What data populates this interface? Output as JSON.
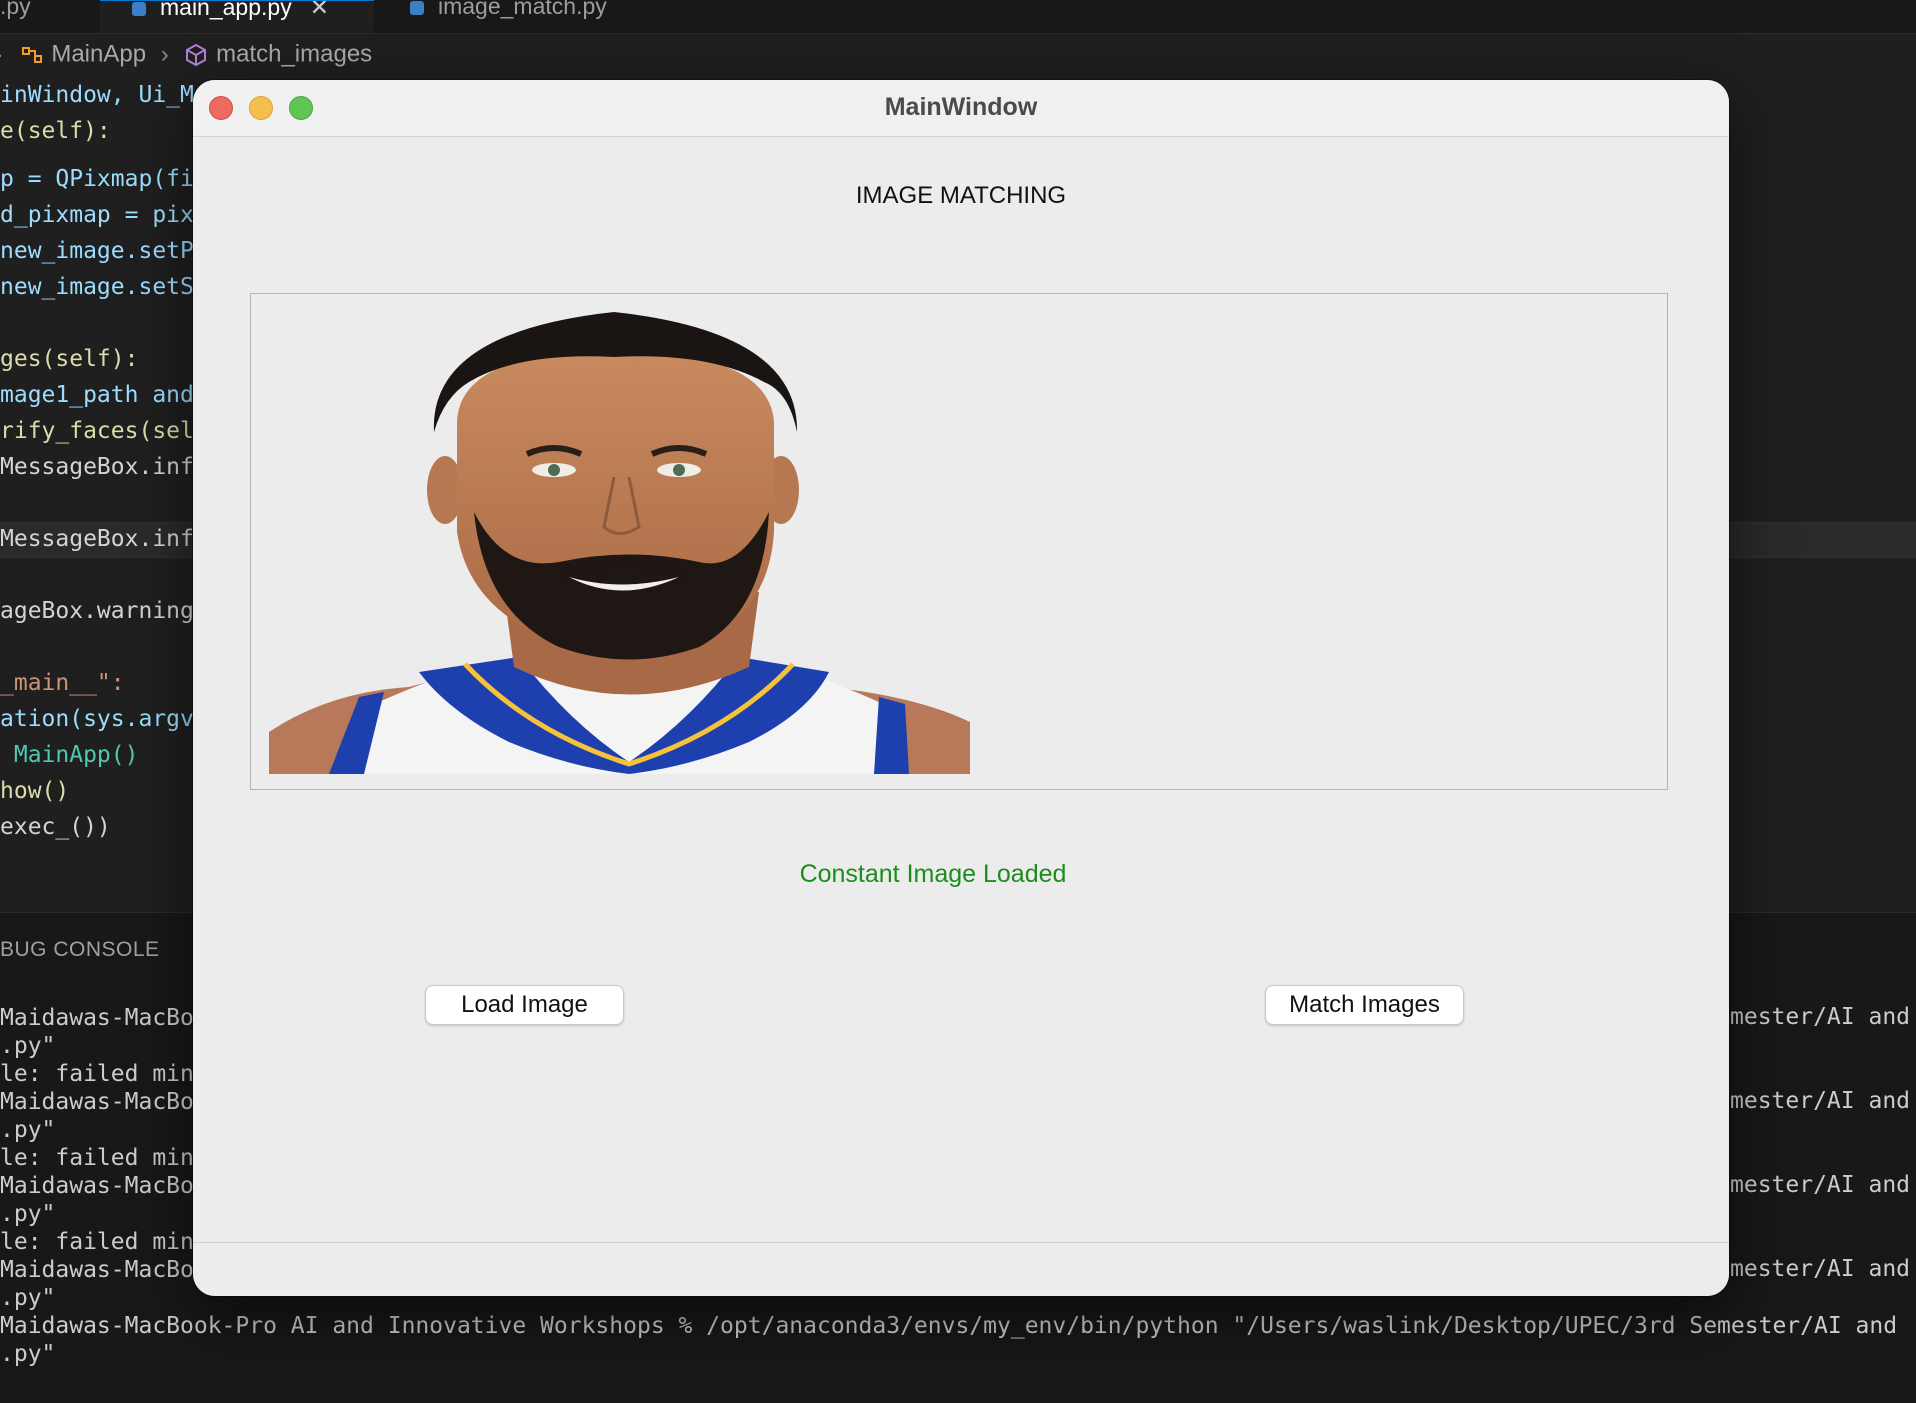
{
  "editor": {
    "tabs": [
      {
        "label": ".py"
      },
      {
        "label": "main_app.py",
        "close": "✕"
      },
      {
        "label": "image_match.py"
      }
    ],
    "breadcrumb": {
      "class_name": "MainApp",
      "method_name": "match_images",
      "separator": "›"
    },
    "code_lines": [
      "inWindow, Ui_M",
      "e(self):",
      "p = QPixmap(fi",
      "d_pixmap = pix",
      "new_image.setP",
      "new_image.setS",
      "",
      "ges(self):",
      "mage1_path and",
      "rify_faces(sel",
      "MessageBox.inf",
      "",
      "MessageBox.inf",
      "",
      "ageBox.warning",
      "",
      "_main__\":",
      "ation(sys.argv",
      " MainApp()",
      "how()",
      "exec_())"
    ]
  },
  "panel": {
    "title": "BUG CONSOLE",
    "terminal_left": [
      "Maidawas-MacBoo",
      ".py\"",
      "le: failed min",
      "Maidawas-MacBoo",
      ".py\"",
      "le: failed min",
      "Maidawas-MacBoo",
      ".py\"",
      "le: failed min",
      "Maidawas-MacBoo",
      ".py\""
    ],
    "terminal_right": [
      "mester/AI and",
      "mester/AI and",
      "mester/AI and",
      "mester/AI and"
    ],
    "last_command": "Maidawas-MacBook-Pro AI and Innovative Workshops % /opt/anaconda3/envs/my_env/bin/python \"/Users/waslink/Desktop/UPEC/3rd Semester/AI and",
    "last_line": ".py\""
  },
  "window": {
    "title": "MainWindow",
    "heading": "IMAGE MATCHING",
    "status": "Constant Image Loaded",
    "load_button": "Load Image",
    "match_button": "Match Images",
    "status_color": "#1c8c1c"
  }
}
